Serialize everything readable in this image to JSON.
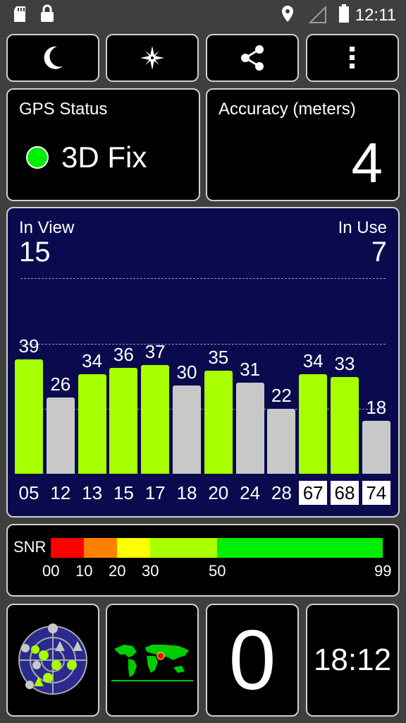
{
  "status_bar": {
    "time": "12:11"
  },
  "gps_status": {
    "title": "GPS Status",
    "value": "3D Fix",
    "indicator_color": "#00ee00"
  },
  "accuracy": {
    "title": "Accuracy (meters)",
    "value": "4"
  },
  "satellites": {
    "in_view_label": "In View",
    "in_view": "15",
    "in_use_label": "In Use",
    "in_use": "7",
    "bars": [
      {
        "prn": "05",
        "snr": "39",
        "used": true,
        "boxed": false
      },
      {
        "prn": "12",
        "snr": "26",
        "used": false,
        "boxed": false
      },
      {
        "prn": "13",
        "snr": "34",
        "used": true,
        "boxed": false
      },
      {
        "prn": "15",
        "snr": "36",
        "used": true,
        "boxed": false
      },
      {
        "prn": "17",
        "snr": "37",
        "used": true,
        "boxed": false
      },
      {
        "prn": "18",
        "snr": "30",
        "used": false,
        "boxed": false
      },
      {
        "prn": "20",
        "snr": "35",
        "used": true,
        "boxed": false
      },
      {
        "prn": "24",
        "snr": "31",
        "used": false,
        "boxed": false
      },
      {
        "prn": "28",
        "snr": "22",
        "used": false,
        "boxed": false
      },
      {
        "prn": "67",
        "snr": "34",
        "used": true,
        "boxed": true
      },
      {
        "prn": "68",
        "snr": "33",
        "used": true,
        "boxed": true
      },
      {
        "prn": "74",
        "snr": "18",
        "used": false,
        "boxed": true
      }
    ],
    "used_color": "#a8ff00",
    "unused_color": "#c8c8c8"
  },
  "snr_scale": {
    "label": "SNR",
    "ticks": [
      "00",
      "10",
      "20",
      "30",
      "50",
      "99"
    ],
    "colors": [
      "#ff0000",
      "#ff8000",
      "#ffff00",
      "#a8ff00",
      "#00ee00"
    ]
  },
  "bottom": {
    "count": "0",
    "clock": "18:12"
  },
  "toolbar": {
    "night_icon": "moon-icon",
    "compass_icon": "compass-star-icon",
    "share_icon": "share-icon",
    "menu_icon": "overflow-menu-icon"
  }
}
